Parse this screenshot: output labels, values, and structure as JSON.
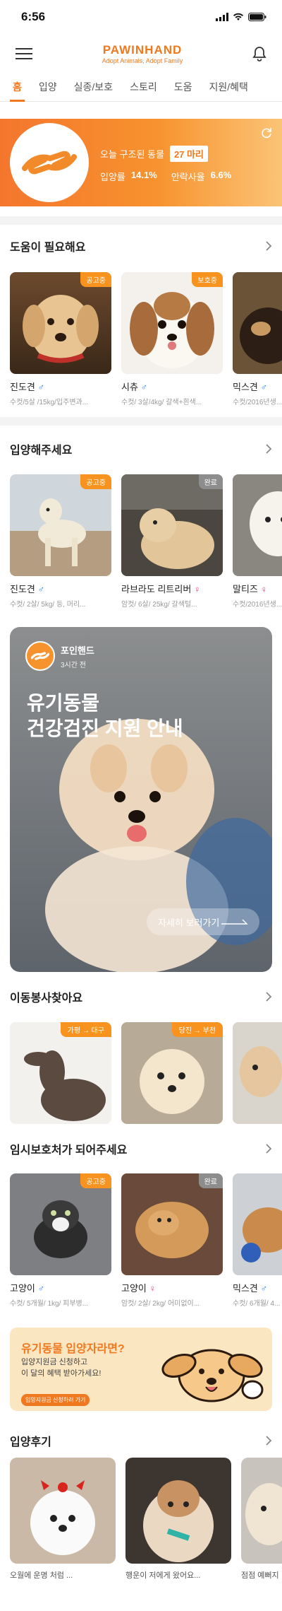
{
  "status_bar": {
    "time": "6:56"
  },
  "header": {
    "brand": "PAWINHAND",
    "tagline": "Adopt Animals, Adopt Family"
  },
  "tabs": [
    {
      "label": "홈",
      "active": true
    },
    {
      "label": "입양"
    },
    {
      "label": "실종/보호"
    },
    {
      "label": "스토리"
    },
    {
      "label": "도움"
    },
    {
      "label": "지원/혜택"
    }
  ],
  "banner": {
    "rescued_label": "오늘 구조된 동물",
    "rescued_count": "27 마리",
    "adoption_label": "입양률",
    "adoption_rate": "14.1%",
    "euthanasia_label": "안락사율",
    "euthanasia_rate": "6.6%"
  },
  "sections": {
    "help": {
      "title": "도움이 필요해요",
      "cards": [
        {
          "badge": "공고중",
          "name": "진도견",
          "gender": "♂",
          "info": "수컷/5살 /15kg/입주변과..."
        },
        {
          "badge": "보호중",
          "name": "시츄",
          "gender": "♂",
          "info": "수컷/ 3살/4kg/ 갈색+흰색..."
        },
        {
          "badge": "",
          "name": "믹스견",
          "gender": "♂",
          "info": "수컷/2016년생..."
        }
      ]
    },
    "adopt": {
      "title": "입양해주세요",
      "cards": [
        {
          "badge": "공고중",
          "name": "진도견",
          "gender": "♂",
          "info": "수컷/ 2살/ 5kg/ 등, 머리..."
        },
        {
          "badge": "완료",
          "name": "라브라도 리트리버",
          "gender": "♀",
          "info": "암컷/ 6살/ 25kg/ 갈색털..."
        },
        {
          "badge": "",
          "name": "말티즈",
          "gender": "♀",
          "info": "수컷/2016년생..."
        }
      ]
    },
    "post": {
      "author": "포인핸드",
      "time": "3시간 전",
      "headline": "유기동물\n건강검진 지원 안내",
      "button": "자세히 보러가기"
    },
    "transport": {
      "title": "이동봉사찾아요",
      "cards": [
        {
          "route": "가평 → 대구"
        },
        {
          "route": "당진 → 부천"
        },
        {
          "route": ""
        }
      ]
    },
    "foster": {
      "title": "임시보호처가 되어주세요",
      "cards": [
        {
          "badge": "공고중",
          "name": "고양이",
          "gender": "♂",
          "info": "수컷/ 5개월/ 1kg/ 피부병..."
        },
        {
          "badge": "완료",
          "name": "고양이",
          "gender": "♀",
          "info": "암컷/ 2살/ 2kg/ 어미없이..."
        },
        {
          "badge": "",
          "name": "믹스견",
          "gender": "♂",
          "info": "수컷/ 6개월/ 4..."
        }
      ]
    },
    "ad": {
      "headline": "유기동물 입양자라면?",
      "desc": "입양지원금 신청하고\n이 달의 혜택 받아가세요!",
      "cta": "입양지원금 신청하러 가기"
    },
    "reviews": {
      "title": "입양후기",
      "items": [
        {
          "caption": "오월에 운명 처럼 ..."
        },
        {
          "caption": "행운이 저에게 왔어요..."
        },
        {
          "caption": "점점 예뻐지"
        }
      ]
    }
  },
  "colors": {
    "accent": "#f0781e",
    "badge": "#f7931e",
    "male": "#3b82e6",
    "female": "#e6407a"
  },
  "icons": [
    "hamburger-icon",
    "bell-icon",
    "refresh-icon",
    "chevron-right-icon",
    "hand-paw-logo-icon",
    "arrow-right-icon"
  ]
}
